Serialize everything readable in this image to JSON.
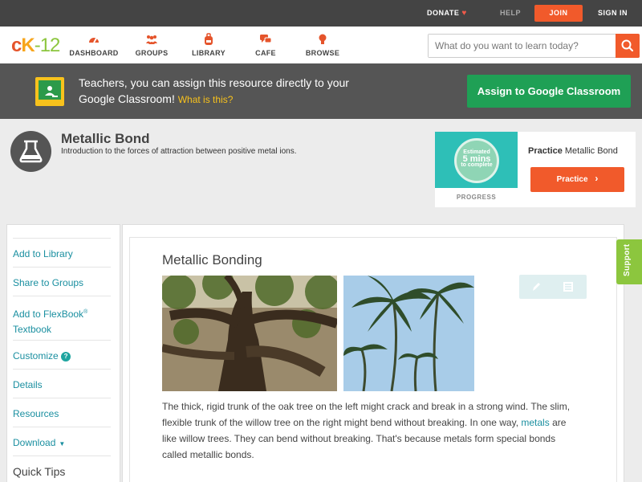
{
  "topbar": {
    "donate": "DONATE",
    "help": "HELP",
    "join": "JOIN",
    "signin": "SIGN IN"
  },
  "nav": {
    "logo_c": "c",
    "logo_k": "K",
    "logo_12": "-12",
    "items": [
      {
        "label": "DASHBOARD",
        "icon": "dashboard-gauge-icon"
      },
      {
        "label": "GROUPS",
        "icon": "groups-people-icon"
      },
      {
        "label": "LIBRARY",
        "icon": "library-backpack-icon"
      },
      {
        "label": "CAFE",
        "icon": "cafe-chat-icon"
      },
      {
        "label": "BROWSE",
        "icon": "browse-lightbulb-icon"
      }
    ],
    "search_placeholder": "What do you want to learn today?"
  },
  "banner": {
    "text": "Teachers, you can assign this resource directly to your Google Classroom!",
    "link": "What is this?",
    "assign_label": "Assign to Google Classroom"
  },
  "concept": {
    "title": "Metallic Bond",
    "description": "Introduction to the forces of attraction between positive metal ions."
  },
  "practice": {
    "estimated": "Estimated",
    "mins": "5 mins",
    "to_complete": "to complete",
    "progress": "PROGRESS",
    "label_bold": "Practice",
    "label_rest": "Metallic Bond",
    "button": "Practice"
  },
  "sidebar": {
    "add_library": "Add to Library",
    "share_groups": "Share to Groups",
    "add_flexbook_1": "Add to FlexBook",
    "add_flexbook_2": "Textbook",
    "customize": "Customize",
    "details": "Details",
    "resources": "Resources",
    "download": "Download",
    "quick_tips": "Quick Tips"
  },
  "lesson": {
    "title": "Metallic Bonding",
    "para_1": "The thick, rigid trunk of the oak tree on the left might crack and break in a strong wind. The slim, flexible trunk of the willow tree on the right might bend without breaking. In one way,",
    "para_link": "metals",
    "para_2": "are like willow trees. They can bend without breaking. That's because metals form special bonds called metallic bonds."
  },
  "support": "Support",
  "colors": {
    "accent_orange": "#f15a2b",
    "google_green": "#1fa055",
    "teal_link": "#1a8fa0",
    "support_green": "#8cc63e"
  }
}
